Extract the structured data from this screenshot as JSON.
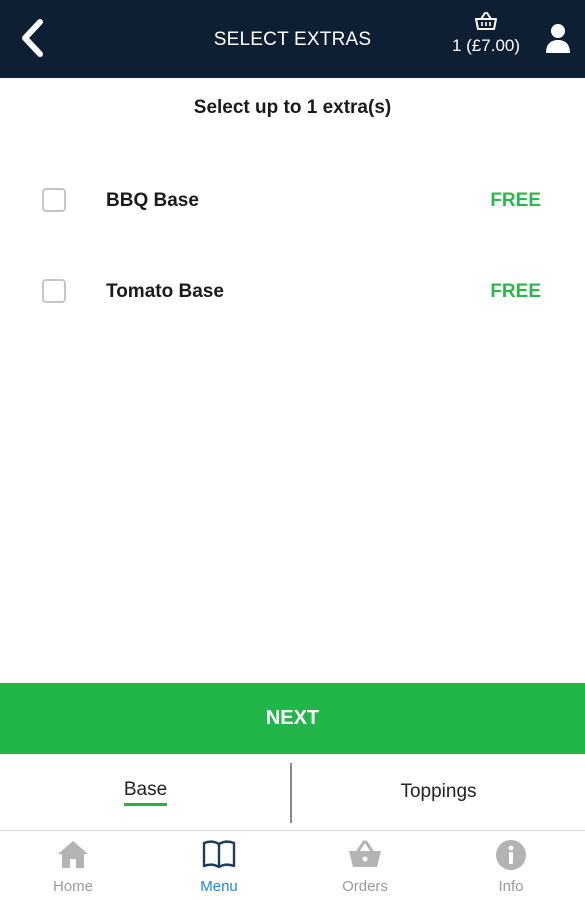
{
  "header": {
    "title": "SELECT EXTRAS",
    "basket_summary": "1 (£7.00)"
  },
  "subtitle": "Select up to 1 extra(s)",
  "extras": [
    {
      "name": "BBQ Base",
      "price": "FREE",
      "checked": false
    },
    {
      "name": "Tomato Base",
      "price": "FREE",
      "checked": false
    }
  ],
  "next_label": "NEXT",
  "stage_tabs": [
    {
      "label": "Base",
      "active": true
    },
    {
      "label": "Toppings",
      "active": false
    }
  ],
  "bottom_nav": [
    {
      "label": "Home",
      "icon": "home-icon",
      "active": false
    },
    {
      "label": "Menu",
      "icon": "book-icon",
      "active": true
    },
    {
      "label": "Orders",
      "icon": "basket-icon",
      "active": false
    },
    {
      "label": "Info",
      "icon": "info-icon",
      "active": false
    }
  ],
  "colors": {
    "header_bg": "#0e1f33",
    "accent_green": "#22b54a",
    "active_nav": "#1e88e5",
    "inactive_nav": "#9a9a9a"
  }
}
